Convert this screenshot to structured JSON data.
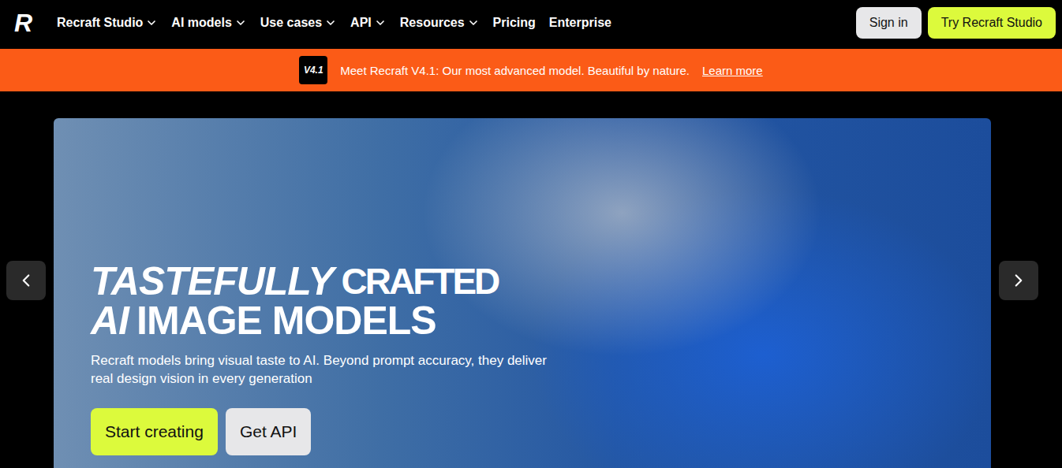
{
  "logo": "R",
  "nav": {
    "items": [
      {
        "label": "Recraft Studio",
        "dropdown": true
      },
      {
        "label": "AI models",
        "dropdown": true
      },
      {
        "label": "Use cases",
        "dropdown": true
      },
      {
        "label": "API",
        "dropdown": true
      },
      {
        "label": "Resources",
        "dropdown": true
      },
      {
        "label": "Pricing",
        "dropdown": false
      },
      {
        "label": "Enterprise",
        "dropdown": false
      }
    ],
    "buttons": [
      {
        "label": "Sign in",
        "kind": "secondary"
      },
      {
        "label": "Try Recraft Studio",
        "kind": "primary"
      }
    ]
  },
  "banner": {
    "badge": "V4.1",
    "text": "Meet Recraft V4.1: Our most advanced model. Beautiful by nature.",
    "link": "Learn more"
  },
  "hero": {
    "title": [
      [
        {
          "text": "TASTEFULLY",
          "kind": "italic"
        },
        {
          "text": "CRAFTED",
          "kind": "condensed"
        }
      ],
      [
        {
          "text": "AI",
          "kind": "italic"
        },
        {
          "text": "IMAGE MODELS",
          "kind": "plain"
        }
      ]
    ],
    "subtitle": "Recraft models bring visual taste to AI. Beyond prompt accuracy, they deliver real design vision in every generation",
    "buttons": [
      {
        "label": "Start creating",
        "kind": "primary"
      },
      {
        "label": "Get API",
        "kind": "secondary"
      }
    ]
  }
}
